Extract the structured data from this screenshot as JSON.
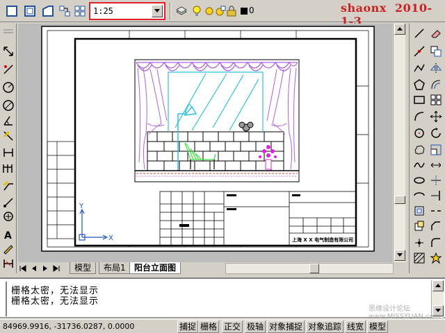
{
  "toolbar": {
    "scale_value": "1:25",
    "layer_value": "0",
    "watermark_name": "shaonx",
    "watermark_date": "2010-1-3"
  },
  "tabs": [
    {
      "label": "模型"
    },
    {
      "label": "布局1"
    },
    {
      "label": "阳台立面图"
    }
  ],
  "command_line": {
    "lines": [
      "栅格太密，无法显示",
      "栅格太密，无法显示"
    ]
  },
  "status": {
    "coords": "84969.9916, -31736.0287, 0.0000",
    "buttons": [
      "捕捉",
      "栅格",
      "正交",
      "极轴",
      "对象捕捉",
      "对象追踪",
      "线宽",
      "模型"
    ]
  },
  "drawing": {
    "company": "上海 X X 电气制造有限公司",
    "axis_y": "Y",
    "axis_x": "X"
  },
  "site_watermark": "思缘设计论坛 www.MISSYUAN.com",
  "colors": {
    "highlight_border": "#e0202a",
    "curtain": "#b060e0",
    "glass": "#30c0e0",
    "brick": "#000000",
    "plant": "#e020e0",
    "chair": "#40e040"
  }
}
